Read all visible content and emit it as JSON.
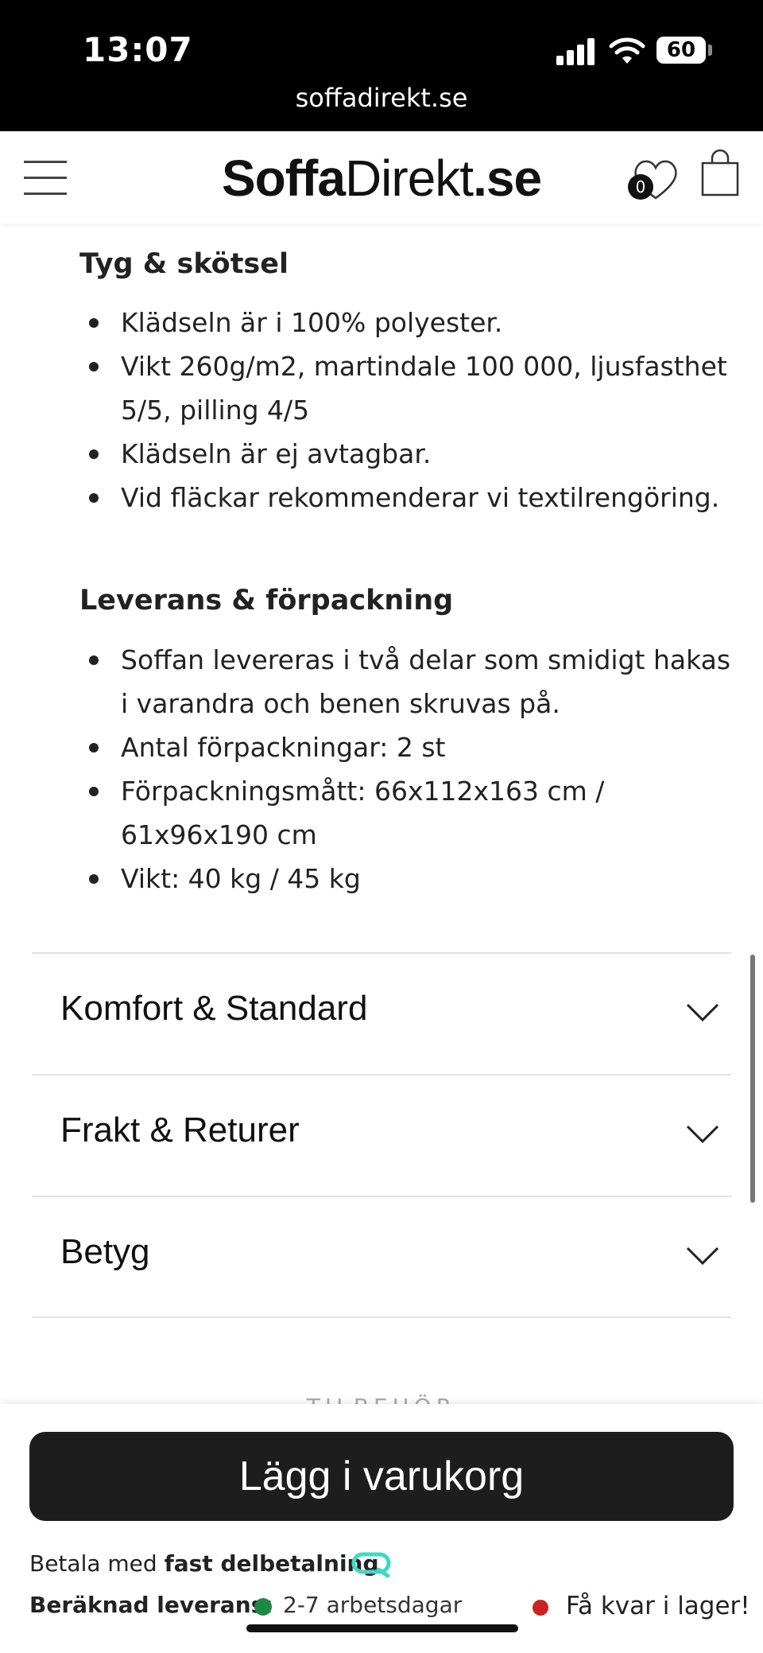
{
  "status_bar": {
    "time": "13:07",
    "battery": "60",
    "url": "soffadirekt.se"
  },
  "header": {
    "logo_bold": "Soffa",
    "logo_thin": "Direkt",
    "logo_suffix": ".se",
    "wishlist_count": "0"
  },
  "care_section": {
    "title": "Tyg & skötsel",
    "items": [
      "Klädseln är i 100% polyester.",
      "Vikt 260g/m2, martindale 100 000, ljusfasthet 5/5, pilling 4/5",
      "Klädseln är ej avtagbar.",
      "Vid fläckar rekommenderar vi textilrengöring."
    ]
  },
  "delivery_section": {
    "title": "Leverans & förpackning",
    "items": [
      "Soffan levereras i två delar som smidigt hakas i varandra och benen skruvas på.",
      "Antal förpackningar: 2 st",
      "Förpackningsmått: 66x112x163 cm / 61x96x190 cm",
      "Vikt: 40 kg / 45 kg"
    ]
  },
  "accordions": [
    {
      "label": "Komfort & Standard"
    },
    {
      "label": "Frakt & Returer"
    },
    {
      "label": "Betyg"
    }
  ],
  "peek_text": "TILBEHÖR",
  "bottom_bar": {
    "cta_label": "Lägg i varukorg",
    "pay_prefix": "Betala med ",
    "pay_bold": "fast delbetalning",
    "delivery_label": "Beräknad leverans:",
    "delivery_days": "2-7 arbetsdagar",
    "stock_text": "Få kvar i lager!"
  },
  "colors": {
    "cta_bg": "#1d1d1d",
    "in_stock_dot": "#1a8a44",
    "low_stock_dot": "#cc2222",
    "pay_logo": "#3fd9c2"
  }
}
